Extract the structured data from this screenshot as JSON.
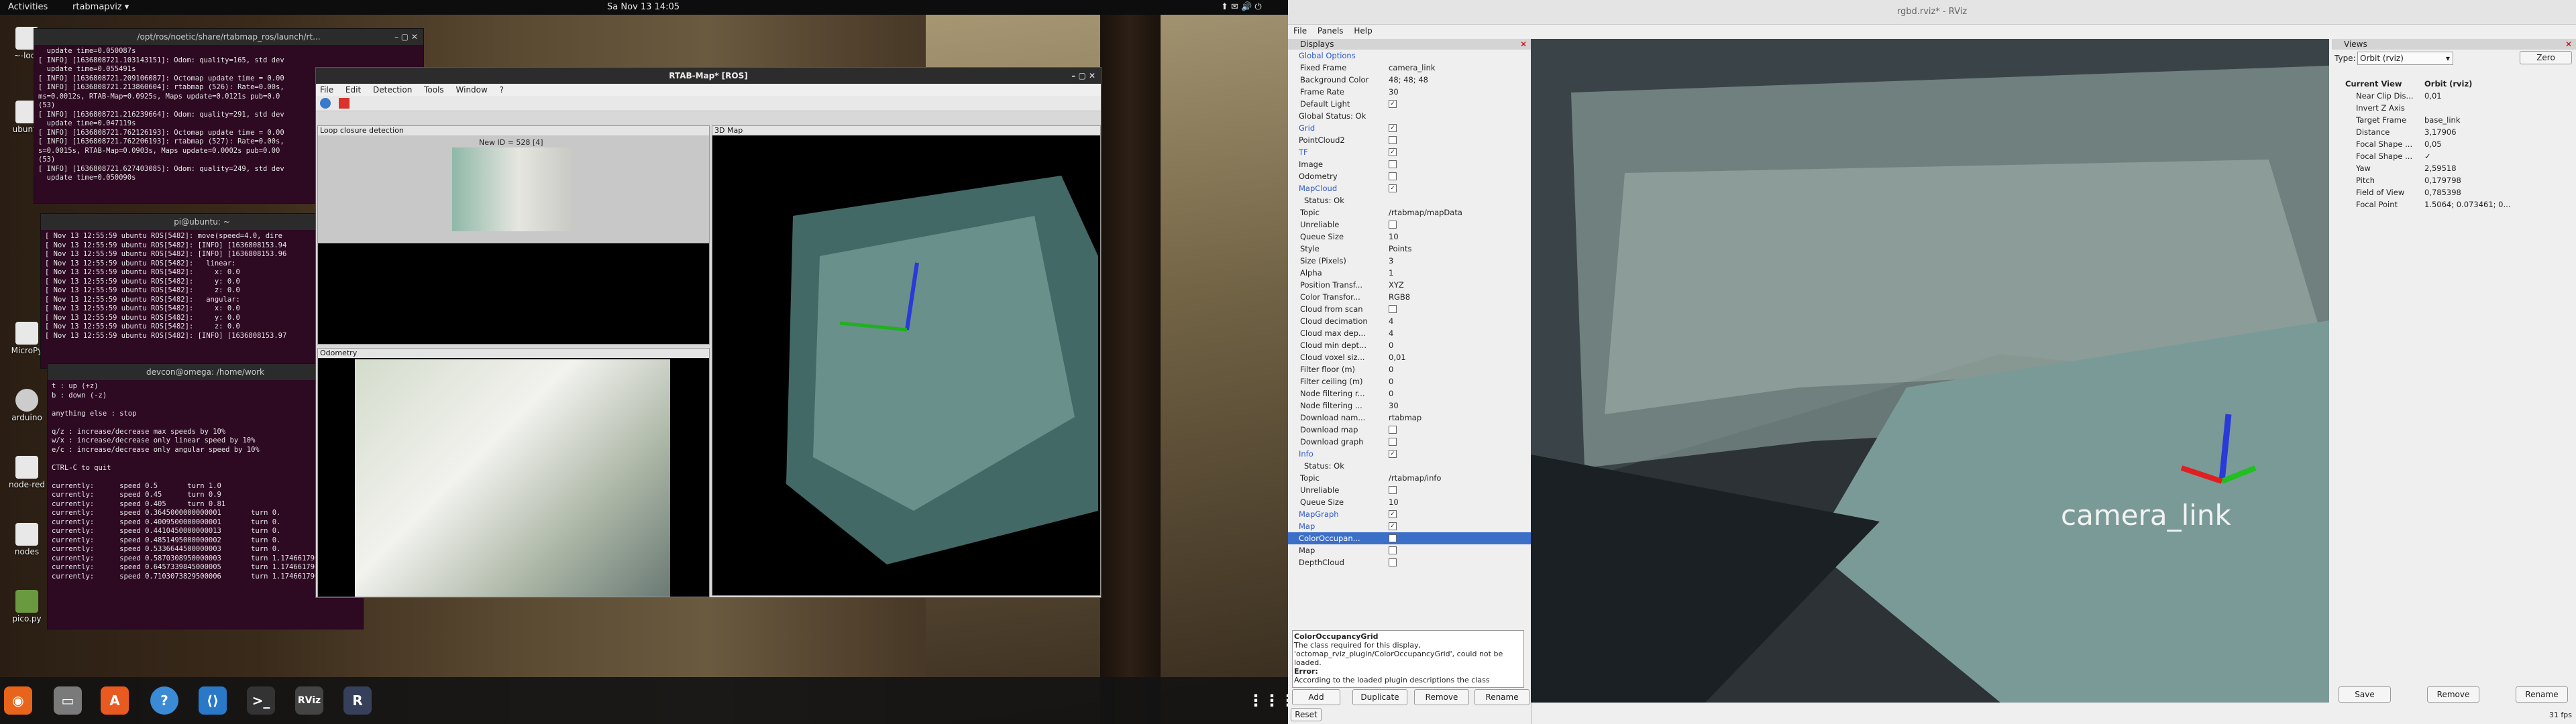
{
  "topbar": {
    "activities": "Activities",
    "app": "rtabmapviz ▾",
    "clock": "Sa Nov 13  14:05"
  },
  "desktop_icons": [
    "~-lock",
    "ubuntu",
    "MicroPy",
    "arduino",
    "node-red",
    "nodes",
    "pico.py"
  ],
  "term1": {
    "title": "/opt/ros/noetic/share/rtabmap_ros/launch/rt...",
    "lines": [
      "  update time=0.050087s",
      "[ INFO] [1636808721.103143151]: Odom: quality=165, std dev",
      "  update time=0.055491s",
      "[ INFO] [1636808721.209106087]: Octomap update time = 0.00",
      "[ INFO] [1636808721.213860604]: rtabmap (526): Rate=0.00s,",
      "ms=0.0012s, RTAB-Map=0.0925s, Maps update=0.0121s pub=0.0",
      "(53)",
      "[ INFO] [1636808721.216239664]: Odom: quality=291, std dev",
      "  update time=0.047119s",
      "[ INFO] [1636808721.762126193]: Octomap update time = 0.00",
      "[ INFO] [1636808721.762206193]: rtabmap (527): Rate=0.00s,",
      "s=0.0015s, RTAB-Map=0.0903s, Maps update=0.0002s pub=0.00",
      "(53)",
      "[ INFO] [1636808721.627403085]: Odom: quality=249, std dev",
      "  update time=0.050090s"
    ]
  },
  "term2": {
    "title": "pi@ubuntu: ~",
    "lines": [
      "[ Nov 13 12:55:59 ubuntu ROS[5482]: move(speed=4.0, dire",
      "[ Nov 13 12:55:59 ubuntu ROS[5482]: [INFO] [1636808153.94",
      "[ Nov 13 12:55:59 ubuntu ROS[5482]: [INFO] [1636808153.96",
      "[ Nov 13 12:55:59 ubuntu ROS[5482]:   linear:",
      "[ Nov 13 12:55:59 ubuntu ROS[5482]:     x: 0.0",
      "[ Nov 13 12:55:59 ubuntu ROS[5482]:     y: 0.0",
      "[ Nov 13 12:55:59 ubuntu ROS[5482]:     z: 0.0",
      "[ Nov 13 12:55:59 ubuntu ROS[5482]:   angular:",
      "[ Nov 13 12:55:59 ubuntu ROS[5482]:     x: 0.0",
      "[ Nov 13 12:55:59 ubuntu ROS[5482]:     y: 0.0",
      "[ Nov 13 12:55:59 ubuntu ROS[5482]:     z: 0.0",
      "[ Nov 13 12:55:59 ubuntu ROS[5482]: [INFO] [1636808153.97"
    ]
  },
  "term3": {
    "title": "devcon@omega: /home/work",
    "lines": [
      "t : up (+z)",
      "b : down (-z)",
      "",
      "anything else : stop",
      "",
      "q/z : increase/decrease max speeds by 10%",
      "w/x : increase/decrease only linear speed by 10%",
      "e/c : increase/decrease only angular speed by 10%",
      "",
      "CTRL-C to quit",
      "",
      "currently:      speed 0.5       turn 1.0",
      "currently:      speed 0.45      turn 0.9",
      "currently:      speed 0.405     turn 0.81",
      "currently:      speed 0.3645000000000001       turn 0.",
      "currently:      speed 0.4009500000000001       turn 0.",
      "currently:      speed 0.4410450000000013       turn 0.",
      "currently:      speed 0.4851495000000002       turn 0.",
      "currently:      speed 0.5336644500000003       turn 0.",
      "currently:      speed 0.5870308950000003       turn 1.1746617900000008",
      "currently:      speed 0.6457339845000005       turn 1.1746617900000008",
      "currently:      speed 0.7103073829500006       turn 1.1746617900000008"
    ]
  },
  "rtab": {
    "title": "RTAB-Map* [ROS]",
    "menu": [
      "File",
      "Edit",
      "Detection",
      "Tools",
      "Window",
      "?"
    ],
    "loop_title": "Loop closure detection",
    "new_id": "New ID = 528 [4]",
    "odom_title": "Odometry",
    "map3d_title": "3D Map"
  },
  "dock_apps": [
    "Firefox",
    "Files",
    "Software",
    "Help",
    "VS Code",
    "Terminal",
    "RViz",
    "R"
  ],
  "rviz": {
    "title": "rgbd.rviz* - RViz",
    "menu": [
      "File",
      "Panels",
      "Help"
    ],
    "displays_title": "Displays",
    "views_title": "Views",
    "rows": [
      {
        "n": "Global Options",
        "v": "",
        "d": 1,
        "cls": "blue",
        "cb": ""
      },
      {
        "n": "Fixed Frame",
        "v": "camera_link",
        "d": 3,
        "cls": "",
        "cb": ""
      },
      {
        "n": "Background Color",
        "v": "48; 48; 48",
        "d": 3,
        "cls": "",
        "cb": ""
      },
      {
        "n": "Frame Rate",
        "v": "30",
        "d": 3,
        "cls": "",
        "cb": ""
      },
      {
        "n": "Default Light",
        "v": "",
        "d": 3,
        "cls": "",
        "cb": "✓"
      },
      {
        "n": "Global Status: Ok",
        "v": "",
        "d": 1,
        "cls": "",
        "cb": ""
      },
      {
        "n": "Grid",
        "v": "",
        "d": 1,
        "cls": "blue",
        "cb": "✓"
      },
      {
        "n": "PointCloud2",
        "v": "",
        "d": 1,
        "cls": "",
        "cb": " "
      },
      {
        "n": "TF",
        "v": "",
        "d": 1,
        "cls": "blue",
        "cb": "✓"
      },
      {
        "n": "Image",
        "v": "",
        "d": 1,
        "cls": "",
        "cb": " "
      },
      {
        "n": "Odometry",
        "v": "",
        "d": 1,
        "cls": "",
        "cb": " "
      },
      {
        "n": "MapCloud",
        "v": "",
        "d": 1,
        "cls": "blue",
        "cb": "✓"
      },
      {
        "n": "Status: Ok",
        "v": "",
        "d": 2,
        "cls": "",
        "cb": ""
      },
      {
        "n": "Topic",
        "v": "/rtabmap/mapData",
        "d": 3,
        "cls": "",
        "cb": ""
      },
      {
        "n": "Unreliable",
        "v": "",
        "d": 3,
        "cls": "",
        "cb": " "
      },
      {
        "n": "Queue Size",
        "v": "10",
        "d": 3,
        "cls": "",
        "cb": ""
      },
      {
        "n": "Style",
        "v": "Points",
        "d": 3,
        "cls": "",
        "cb": ""
      },
      {
        "n": "Size (Pixels)",
        "v": "3",
        "d": 3,
        "cls": "",
        "cb": ""
      },
      {
        "n": "Alpha",
        "v": "1",
        "d": 3,
        "cls": "",
        "cb": ""
      },
      {
        "n": "Position Transf...",
        "v": "XYZ",
        "d": 3,
        "cls": "",
        "cb": ""
      },
      {
        "n": "Color Transfor...",
        "v": "RGB8",
        "d": 3,
        "cls": "",
        "cb": ""
      },
      {
        "n": "Cloud from scan",
        "v": "",
        "d": 3,
        "cls": "",
        "cb": " "
      },
      {
        "n": "Cloud decimation",
        "v": "4",
        "d": 3,
        "cls": "",
        "cb": ""
      },
      {
        "n": "Cloud max dep...",
        "v": "4",
        "d": 3,
        "cls": "",
        "cb": ""
      },
      {
        "n": "Cloud min dept...",
        "v": "0",
        "d": 3,
        "cls": "",
        "cb": ""
      },
      {
        "n": "Cloud voxel siz...",
        "v": "0,01",
        "d": 3,
        "cls": "",
        "cb": ""
      },
      {
        "n": "Filter floor (m)",
        "v": "0",
        "d": 3,
        "cls": "",
        "cb": ""
      },
      {
        "n": "Filter ceiling (m)",
        "v": "0",
        "d": 3,
        "cls": "",
        "cb": ""
      },
      {
        "n": "Node filtering r...",
        "v": "0",
        "d": 3,
        "cls": "",
        "cb": ""
      },
      {
        "n": "Node filtering ...",
        "v": "30",
        "d": 3,
        "cls": "",
        "cb": ""
      },
      {
        "n": "Download nam...",
        "v": "rtabmap",
        "d": 3,
        "cls": "",
        "cb": ""
      },
      {
        "n": "Download map",
        "v": "",
        "d": 3,
        "cls": "",
        "cb": " "
      },
      {
        "n": "Download graph",
        "v": "",
        "d": 3,
        "cls": "",
        "cb": " "
      },
      {
        "n": "Info",
        "v": "",
        "d": 1,
        "cls": "blue",
        "cb": "✓"
      },
      {
        "n": "Status: Ok",
        "v": "",
        "d": 2,
        "cls": "",
        "cb": ""
      },
      {
        "n": "Topic",
        "v": "/rtabmap/info",
        "d": 3,
        "cls": "",
        "cb": ""
      },
      {
        "n": "Unreliable",
        "v": "",
        "d": 3,
        "cls": "",
        "cb": " "
      },
      {
        "n": "Queue Size",
        "v": "10",
        "d": 3,
        "cls": "",
        "cb": ""
      },
      {
        "n": "MapGraph",
        "v": "",
        "d": 1,
        "cls": "blue",
        "cb": "✓"
      },
      {
        "n": "Map",
        "v": "",
        "d": 1,
        "cls": "blue",
        "cb": "✓"
      },
      {
        "n": "ColorOccupan...",
        "v": "",
        "d": 1,
        "cls": "sel",
        "cb": " "
      },
      {
        "n": "Map",
        "v": "",
        "d": 1,
        "cls": "",
        "cb": " "
      },
      {
        "n": "DepthCloud",
        "v": "",
        "d": 1,
        "cls": "",
        "cb": " "
      }
    ],
    "desc_title": "ColorOccupancyGrid",
    "desc_text": "The class required for this display, 'octomap_rviz_plugin/ColorOccupancyGrid', could not be loaded.",
    "desc_error": "Error:",
    "desc_more": "According to the loaded plugin descriptions the class",
    "buttons": {
      "add": "Add",
      "duplicate": "Duplicate",
      "remove": "Remove",
      "rename": "Rename",
      "reset": "Reset"
    },
    "views": {
      "type_label": "Type:",
      "type_value": "Orbit (rviz)",
      "zero": "Zero",
      "current_view": "Current View",
      "current_view_value": "Orbit (rviz)",
      "props": [
        {
          "n": "Near Clip Dis...",
          "v": "0,01"
        },
        {
          "n": "Invert Z Axis",
          "v": ""
        },
        {
          "n": "Target Frame",
          "v": "base_link"
        },
        {
          "n": "Distance",
          "v": "3,17906"
        },
        {
          "n": "Focal Shape ...",
          "v": "0,05"
        },
        {
          "n": "Focal Shape ...",
          "v": "✓"
        },
        {
          "n": "Yaw",
          "v": "2,59518"
        },
        {
          "n": "Pitch",
          "v": "0,179798"
        },
        {
          "n": "Field of View",
          "v": "0,785398"
        },
        {
          "n": "Focal Point",
          "v": "1.5064; 0.073461; 0..."
        }
      ],
      "save": "Save",
      "remove": "Remove",
      "rename": "Rename"
    },
    "overlay_label": "camera_link",
    "fps": "31 fps"
  }
}
